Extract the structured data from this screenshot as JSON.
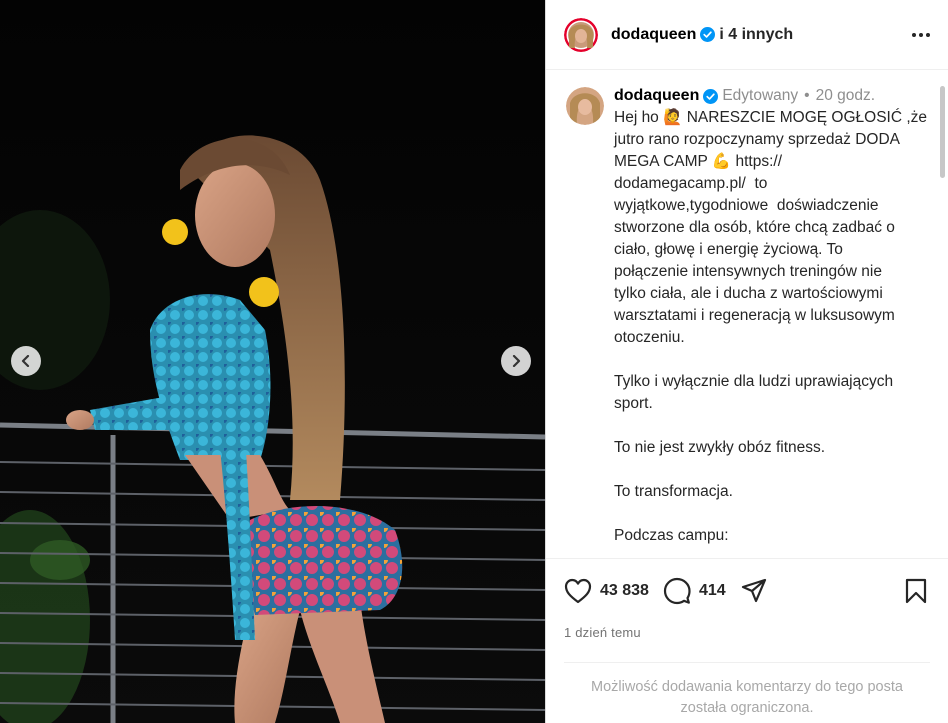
{
  "post": {
    "author": "dodaqueen",
    "coauthors": "i 4 innych",
    "edited_label": "Edytowany",
    "time": "20 godz.",
    "caption_lines": [
      "Hej ho 🙋 NARESZCIE MOGĘ OGŁOSIĆ ,że",
      "jutro rano rozpoczynamy sprzedaż DODA",
      "MEGA CAMP 💪 https://",
      "dodamegacamp.pl/  to",
      "wyjątkowe,tygodniowe  doświadczenie",
      "stworzone dla osób, które chcą zadbać o",
      "ciało, głowę i energię życiową. To",
      "połączenie intensywnych treningów nie",
      "tylko ciała, ale i ducha z wartościowymi",
      "warsztatami i regeneracją w luksusowym",
      "otoczeniu.",
      "",
      "Tylko i wyłącznie dla ludzi uprawiających",
      "sport.",
      "",
      "To nie jest zwykły obóz fitness.",
      "",
      "To transformacja.",
      "",
      "Podczas campu:"
    ],
    "likes": "43 838",
    "comments": "414",
    "posted_ago": "1 dzień temu",
    "comments_disabled_line1": "Możliwość dodawania komentarzy do tego posta",
    "comments_disabled_line2": "została ograniczona."
  },
  "carousel": {
    "slides": 8,
    "active": 5
  },
  "icons": {
    "verified": "verified-badge-icon",
    "like": "heart-icon",
    "comment": "comment-bubble-icon",
    "share": "paper-plane-icon",
    "save": "bookmark-icon",
    "more": "more-options-icon",
    "prev": "chevron-left-icon",
    "next": "chevron-right-icon"
  },
  "colors": {
    "verified": "#0095f6",
    "text": "#262626",
    "muted": "#8e8e8e",
    "avatar_ring": "#e4002b"
  }
}
